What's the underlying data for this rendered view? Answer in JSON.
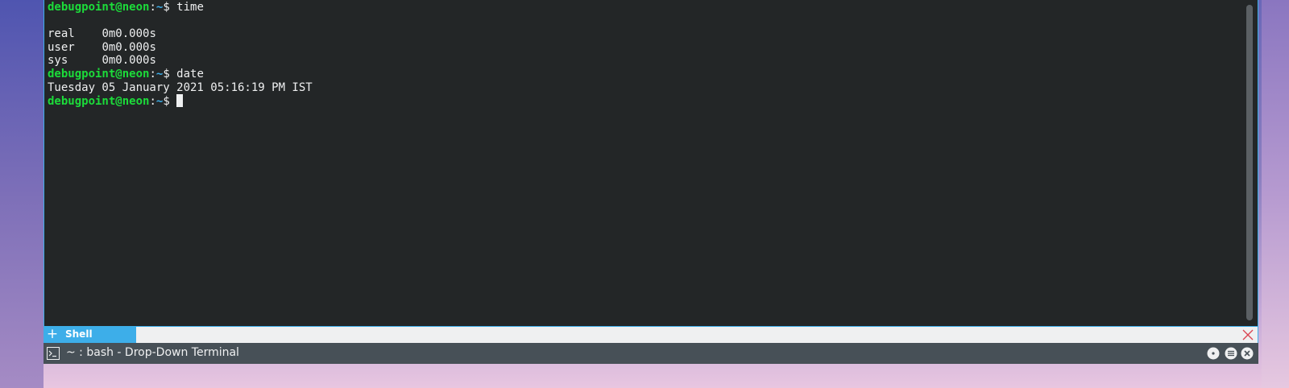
{
  "terminal": {
    "lines": [
      {
        "type": "prompt",
        "user": "debugpoint@neon",
        "colon": ":",
        "path": "~",
        "symbol": "$ ",
        "command": "time"
      },
      {
        "type": "output",
        "text": ""
      },
      {
        "type": "output",
        "text": "real\t0m0.000s"
      },
      {
        "type": "output",
        "text": "user\t0m0.000s"
      },
      {
        "type": "output",
        "text": "sys\t0m0.000s"
      },
      {
        "type": "prompt",
        "user": "debugpoint@neon",
        "colon": ":",
        "path": "~",
        "symbol": "$ ",
        "command": "date"
      },
      {
        "type": "output",
        "text": "Tuesday 05 January 2021 05:16:19 PM IST"
      },
      {
        "type": "prompt",
        "user": "debugpoint@neon",
        "colon": ":",
        "path": "~",
        "symbol": "$ ",
        "command": ""
      }
    ]
  },
  "tabbar": {
    "add_glyph": "+",
    "tabs": [
      {
        "label": "Shell",
        "active": true
      }
    ],
    "close_icon": "close-x-icon"
  },
  "titlebar": {
    "title": "~ : bash - Drop-Down Terminal",
    "icon": "terminal-icon",
    "buttons": [
      "configure-icon",
      "menu-icon",
      "close-icon"
    ]
  },
  "colors": {
    "terminal_bg": "#232627",
    "prompt_user": "#1cdc3a",
    "prompt_path": "#3daee9",
    "accent": "#3daee9",
    "titlebar_bg": "#475057"
  }
}
